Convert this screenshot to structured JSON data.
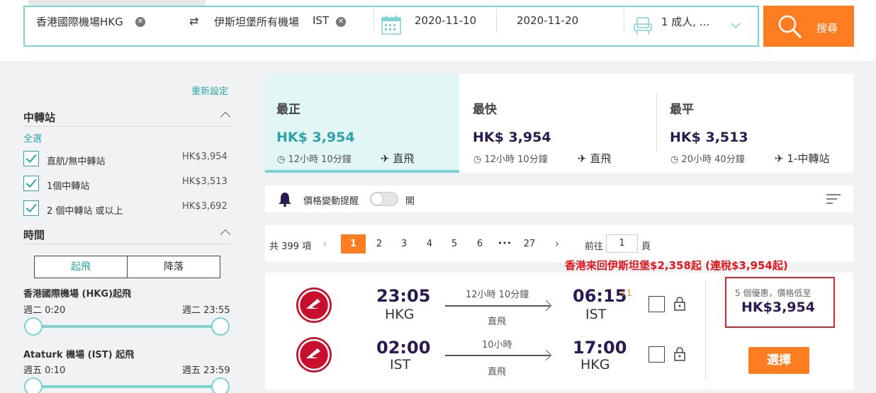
{
  "search": {
    "origin": "香港國際機場HKG",
    "destination": "伊斯坦堡所有機場",
    "destination_code": "IST",
    "depart_date": "2020-11-10",
    "return_date": "2020-11-20",
    "passengers": "1 成人, ...",
    "search_label": "搜尋"
  },
  "sidebar": {
    "reset_label": "重新設定",
    "stops": {
      "title": "中轉站",
      "select_all": "全選",
      "options": [
        {
          "label": "直航/無中轉站",
          "price": "HK$3,954"
        },
        {
          "label": "1個中轉站",
          "price": "HK$3,513"
        },
        {
          "label": "2 個中轉站 或以上",
          "price": "HK$3,692"
        }
      ]
    },
    "time": {
      "title": "時間",
      "tabs": [
        "起飛",
        "降落"
      ],
      "origin_label": "香港國際機場 (HKG)起飛",
      "origin_start": "週二 0:20",
      "origin_end": "週二 23:55",
      "dest_label": "Ataturk 機場 (IST) 起飛",
      "dest_start": "週五 0:10",
      "dest_end": "週五 23:59"
    }
  },
  "sort_cards": [
    {
      "title": "最正",
      "price": "HK$ 3,954",
      "duration": "12小時 10分鐘",
      "stops": "直飛"
    },
    {
      "title": "最快",
      "price": "HK$ 3,954",
      "duration": "12小時 10分鐘",
      "stops": "直飛"
    },
    {
      "title": "最平",
      "price": "HK$ 3,513",
      "duration": "20小時 40分鐘",
      "stops": "1-中轉站"
    }
  ],
  "alert": {
    "label": "價格變動提醒",
    "state": "開"
  },
  "pagination": {
    "total": "共 399 項",
    "pages": [
      "1",
      "2",
      "3",
      "4",
      "5",
      "6",
      "•••",
      "27"
    ],
    "current": "1",
    "goto_label": "前往",
    "goto_value": "1",
    "page_suffix": "頁"
  },
  "promo_text": "香港來回伊斯坦堡$2,358起 (連稅$3,954起)",
  "result": {
    "outbound": {
      "depart_time": "23:05",
      "depart_code": "HKG",
      "duration": "12小時 10分鐘",
      "type": "直飛",
      "arrive_time": "06:15",
      "day_offset": "+1",
      "arrive_code": "IST"
    },
    "inbound": {
      "depart_time": "02:00",
      "depart_code": "IST",
      "duration": "10小時",
      "type": "直飛",
      "arrive_time": "17:00",
      "arrive_code": "HKG"
    },
    "deals_label": "5 個優惠，價格低至",
    "deal_price": "HK$3,954",
    "select_label": "選擇"
  },
  "colors": {
    "accent": "#ff7d21",
    "teal": "#2fa3a7",
    "promo_red": "#e3161c",
    "navy": "#2a1a4f",
    "airline_red": "#c8102e"
  }
}
